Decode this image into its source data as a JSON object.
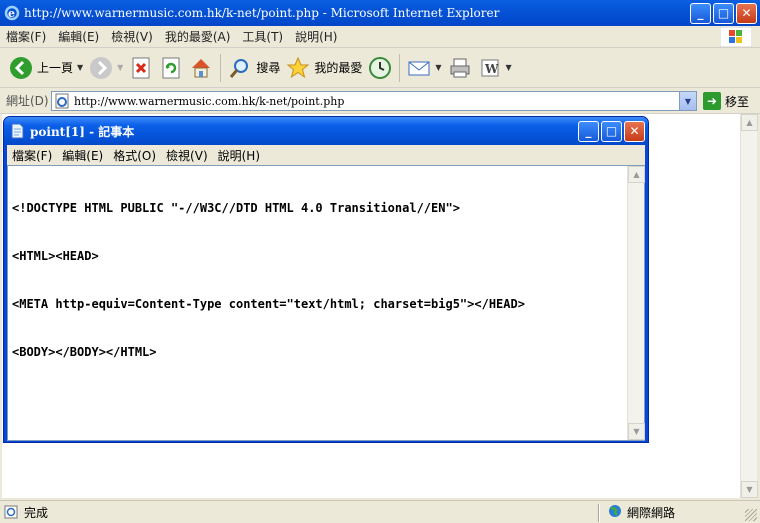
{
  "browser": {
    "title": "http://www.warnermusic.com.hk/k-net/point.php - Microsoft Internet Explorer",
    "menu": [
      "檔案(F)",
      "編輯(E)",
      "檢視(V)",
      "我的最愛(A)",
      "工具(T)",
      "說明(H)"
    ],
    "toolbar": {
      "back_label": "上一頁",
      "search_label": "搜尋",
      "favorites_label": "我的最愛"
    },
    "address": {
      "label": "網址(D)",
      "url": "http://www.warnermusic.com.hk/k-net/point.php",
      "go_label": "移至"
    },
    "status": {
      "text": "完成",
      "zone": "網際網路"
    }
  },
  "notepad": {
    "title": "point[1] - 記事本",
    "menu": [
      "檔案(F)",
      "編輯(E)",
      "格式(O)",
      "檢視(V)",
      "說明(H)"
    ],
    "lines": [
      "<!DOCTYPE HTML PUBLIC \"-//W3C//DTD HTML 4.0 Transitional//EN\">",
      "<HTML><HEAD>",
      "<META http-equiv=Content-Type content=\"text/html; charset=big5\"></HEAD>",
      "<BODY></BODY></HTML>"
    ]
  },
  "colors": {
    "title_blue": "#0553d6",
    "window_face": "#ece9d8",
    "close_red": "#c53a16"
  }
}
